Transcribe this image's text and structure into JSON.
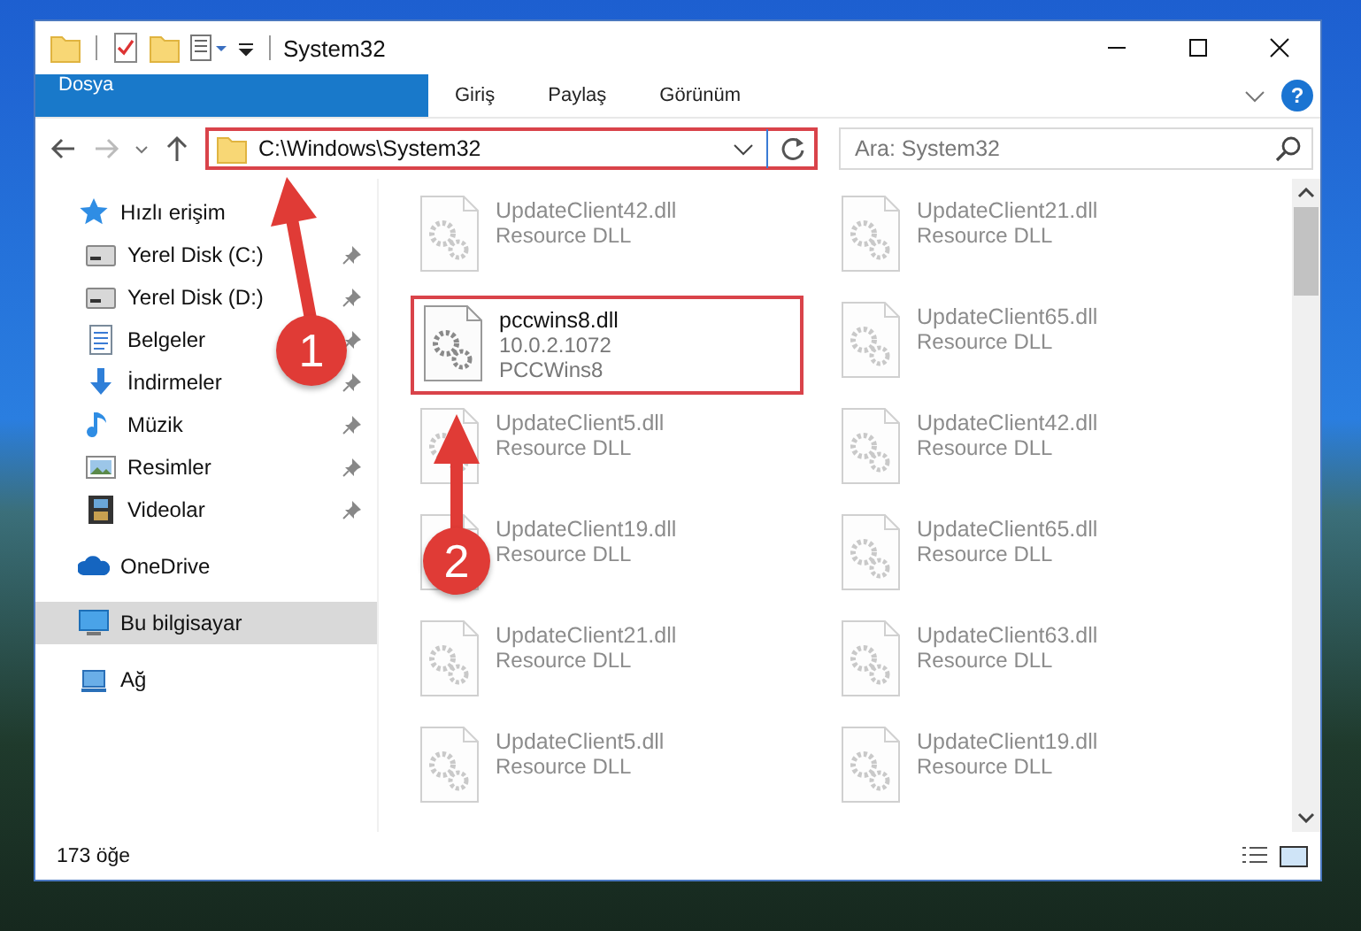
{
  "window": {
    "title": "System32"
  },
  "ribbon": {
    "tabs": [
      {
        "label": "Dosya",
        "kind": "file",
        "selected": false
      },
      {
        "label": "Giriş",
        "kind": "tab",
        "selected": false
      },
      {
        "label": "Paylaş",
        "kind": "tab",
        "selected": false
      },
      {
        "label": "Görünüm",
        "kind": "tab",
        "selected": false
      }
    ]
  },
  "address_bar": {
    "path": "C:\\Windows\\System32",
    "highlighted": true
  },
  "search": {
    "placeholder": "Ara: System32"
  },
  "help_button": {
    "label": "?"
  },
  "sidebar": {
    "items": [
      {
        "label": "Hızlı erişim",
        "selected": false,
        "children": [
          {
            "label": "Yerel Disk (C:)",
            "selected": false,
            "pinned": true
          },
          {
            "label": "Yerel Disk (D:)",
            "selected": false,
            "pinned": true
          },
          {
            "label": "Belgeler",
            "selected": false,
            "pinned": true
          },
          {
            "label": "İndirmeler",
            "selected": false,
            "pinned": true
          },
          {
            "label": "Müzik",
            "selected": false,
            "pinned": true
          },
          {
            "label": "Resimler",
            "selected": false,
            "pinned": true
          },
          {
            "label": "Videolar",
            "selected": false,
            "pinned": true
          }
        ]
      },
      {
        "label": "OneDrive",
        "selected": false
      },
      {
        "label": "Bu bilgisayar",
        "selected": true
      },
      {
        "label": "Ağ",
        "selected": false
      }
    ]
  },
  "files": [
    {
      "name": "UpdateClient42.dll",
      "line_2": "Resource DLL",
      "highlighted": false
    },
    {
      "name": "UpdateClient21.dll",
      "line_2": "Resource DLL",
      "highlighted": false
    },
    {
      "name": "pccwins8.dll",
      "line_2": "10.0.2.1072",
      "line_3": "PCCWins8",
      "highlighted": true
    },
    {
      "name": "UpdateClient65.dll",
      "line_2": "Resource DLL",
      "highlighted": false
    },
    {
      "name": "UpdateClient5.dll",
      "line_2": "Resource DLL",
      "highlighted": false
    },
    {
      "name": "UpdateClient42.dll",
      "line_2": "Resource DLL",
      "highlighted": false
    },
    {
      "name": "UpdateClient19.dll",
      "line_2": "Resource DLL",
      "highlighted": false
    },
    {
      "name": "UpdateClient65.dll",
      "line_2": "Resource DLL",
      "highlighted": false
    },
    {
      "name": "UpdateClient21.dll",
      "line_2": "Resource DLL",
      "highlighted": false
    },
    {
      "name": "UpdateClient63.dll",
      "line_2": "Resource DLL",
      "highlighted": false
    },
    {
      "name": "UpdateClient5.dll",
      "line_2": "Resource DLL",
      "highlighted": false
    },
    {
      "name": "UpdateClient19.dll",
      "line_2": "Resource DLL",
      "highlighted": false
    }
  ],
  "status_bar": {
    "item_count": "173 öğe"
  },
  "annotations": [
    {
      "number": "1"
    },
    {
      "number": "2"
    }
  ]
}
